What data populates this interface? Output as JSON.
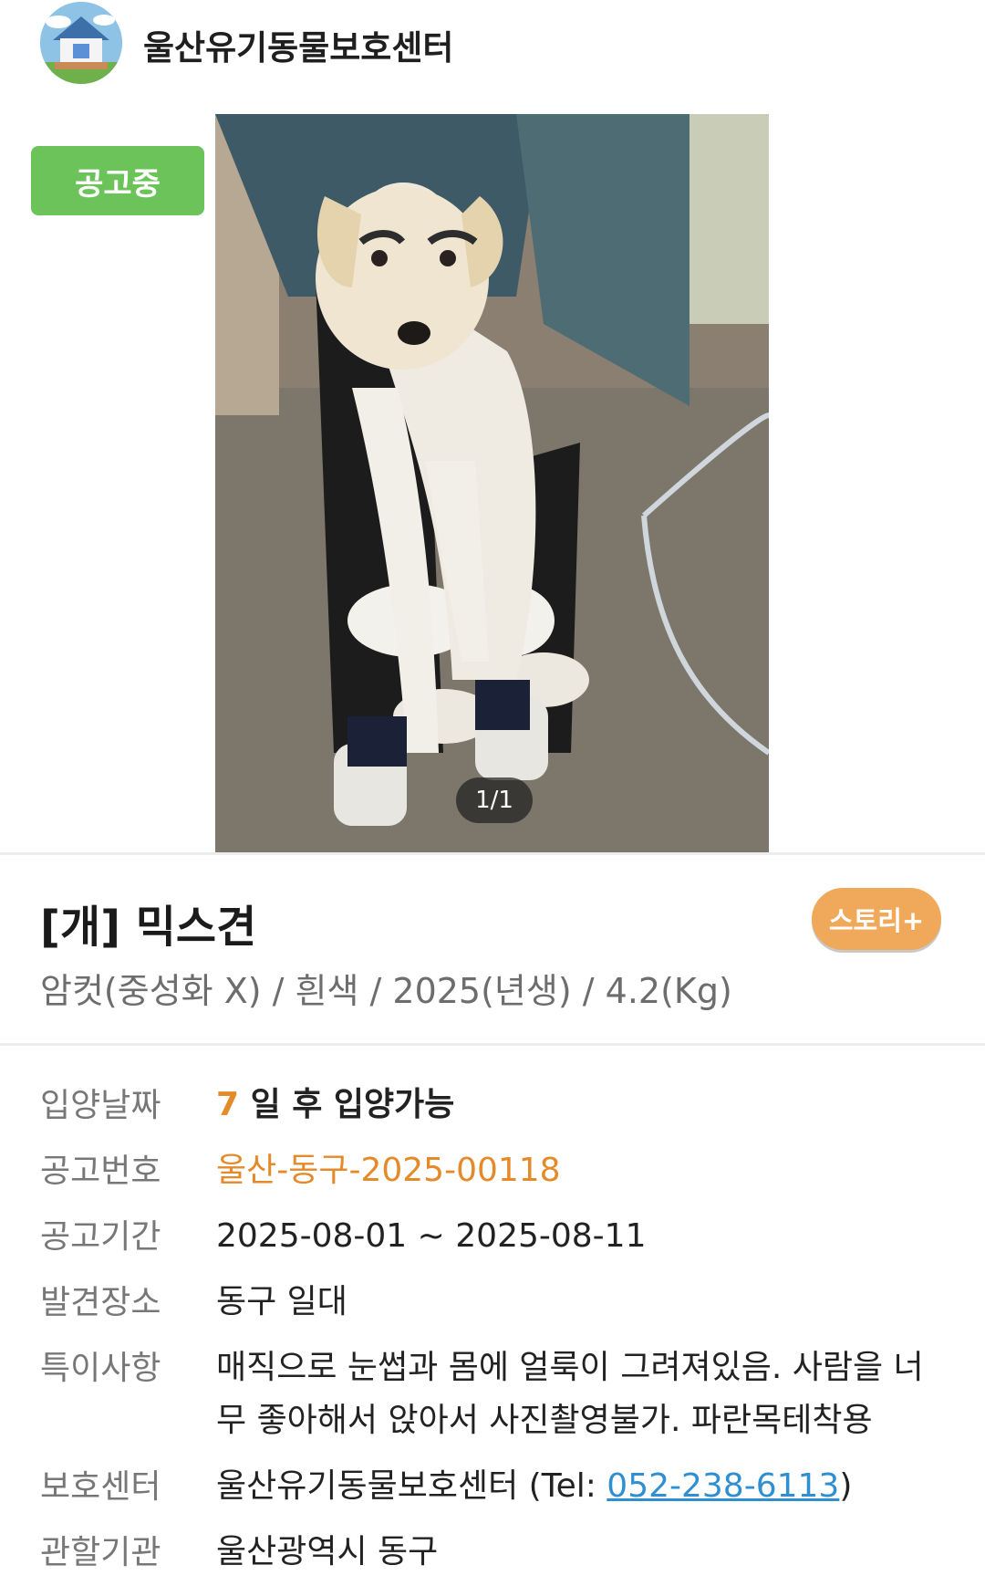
{
  "header": {
    "shelter_name": "울산유기동물보호센터",
    "avatar_icon": "house-icon"
  },
  "status_badge": "공고중",
  "photo": {
    "counter": "1/1"
  },
  "animal": {
    "title": "[개] 믹스견",
    "summary": "암컷(중성화 X) / 흰색 / 2025(년생) / 4.2(Kg)",
    "story_button": "스토리+"
  },
  "details": {
    "adoption_date_label": "입양날짜",
    "adoption_days": "7",
    "adoption_suffix": "일 후 입양가능",
    "notice_no_label": "공고번호",
    "notice_no": "울산-동구-2025-00118",
    "period_label": "공고기간",
    "period": "2025-08-01 ~ 2025-08-11",
    "found_place_label": "발견장소",
    "found_place": "동구 일대",
    "notes_label": "특이사항",
    "notes": "매직으로 눈썹과 몸에 얼룩이 그려져있음. 사람을 너무 좋아해서 앉아서 사진촬영불가. 파란목테착용",
    "shelter_label": "보호센터",
    "shelter_name": "울산유기동물보호센터",
    "shelter_tel_prefix": "(Tel: ",
    "shelter_tel": "052-238-6113",
    "shelter_tel_suffix": ")",
    "authority_label": "관할기관",
    "authority": "울산광역시 동구"
  },
  "colors": {
    "badge_green": "#6cc35a",
    "accent_orange": "#e48a2a",
    "story_orange": "#f0a95a",
    "link_blue": "#2f8fd1"
  }
}
